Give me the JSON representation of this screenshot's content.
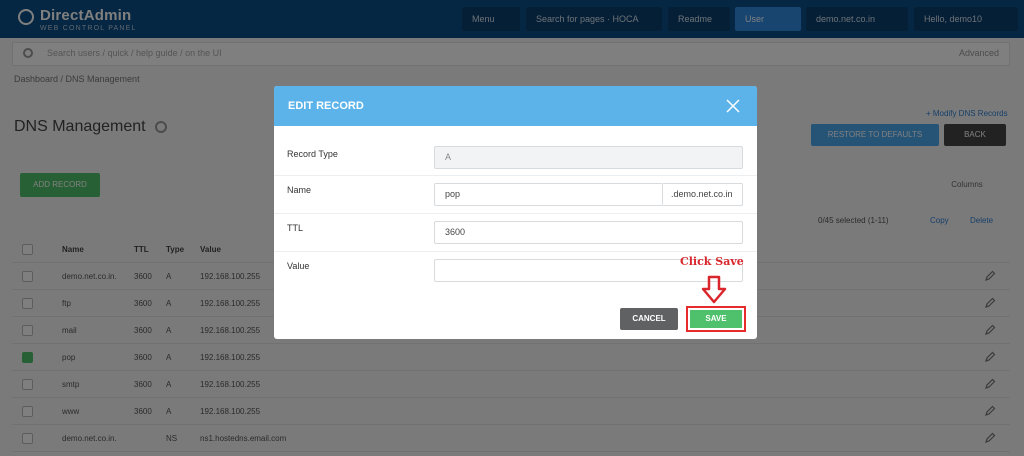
{
  "header": {
    "logo_name": "DirectAdmin",
    "logo_sub": "WEB CONTROL PANEL",
    "buttons": [
      "Menu",
      "Search for pages · HOCA",
      "Readme",
      "User",
      "demo.net.co.in",
      "Hello, demo10"
    ]
  },
  "search": {
    "placeholder": "Search users / quick / help guide / on the UI",
    "advanced_label": "Advanced"
  },
  "breadcrumb": "Dashboard  /  DNS Management",
  "page": {
    "title": "DNS Management",
    "modify_link": "+ Modify DNS Records",
    "reset_label": "RESTORE TO DEFAULTS",
    "back_label": "BACK",
    "add_label": "ADD RECORD",
    "columns_label": "Columns",
    "selection_info": "0/45 selected (1-11)",
    "copy_label": "Copy",
    "delete_label": "Delete"
  },
  "table": {
    "headers": [
      "Name",
      "TTL",
      "Type",
      "Value"
    ],
    "rows": [
      {
        "name": "demo.net.co.in.",
        "ttl": "3600",
        "type": "A",
        "value": "192.168.100.255",
        "checked": false
      },
      {
        "name": "ftp",
        "ttl": "3600",
        "type": "A",
        "value": "192.168.100.255",
        "checked": false
      },
      {
        "name": "mail",
        "ttl": "3600",
        "type": "A",
        "value": "192.168.100.255",
        "checked": false
      },
      {
        "name": "pop",
        "ttl": "3600",
        "type": "A",
        "value": "192.168.100.255",
        "checked": true
      },
      {
        "name": "smtp",
        "ttl": "3600",
        "type": "A",
        "value": "192.168.100.255",
        "checked": false
      },
      {
        "name": "www",
        "ttl": "3600",
        "type": "A",
        "value": "192.168.100.255",
        "checked": false
      },
      {
        "name": "demo.net.co.in.",
        "ttl": "",
        "type": "NS",
        "value": "ns1.hostedns.email.com",
        "checked": false
      }
    ]
  },
  "modal": {
    "title": "EDIT RECORD",
    "record_type_label": "Record Type",
    "record_type_value": "A",
    "name_label": "Name",
    "name_value": "pop",
    "name_suffix": ".demo.net.co.in",
    "ttl_label": "TTL",
    "ttl_value": "3600",
    "value_label": "Value",
    "value_value": "",
    "cancel_label": "CANCEL",
    "save_label": "SAVE"
  },
  "annotation": {
    "text": "Click Save",
    "color": "#d9262c"
  },
  "colors": {
    "header": "#0d4f86",
    "modal_header": "#5bb3ea",
    "save": "#4fc06b",
    "cancel": "#5f6163",
    "highlight": "#e52b2b"
  }
}
